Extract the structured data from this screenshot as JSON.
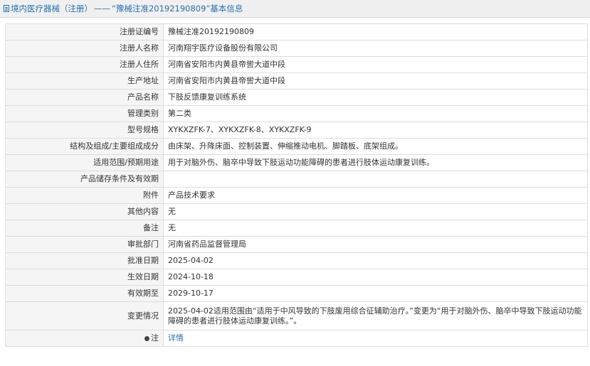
{
  "header": {
    "title_left": "境内医疗器械（注册）",
    "separator": "——",
    "title_right": "“豫械注准20192190809”基本信息"
  },
  "rows": [
    {
      "label": "注册证编号",
      "value": "豫械注准20192190809"
    },
    {
      "label": "注册人名称",
      "value": "河南翔宇医疗设备股份有限公司"
    },
    {
      "label": "注册人住所",
      "value": "河南省安阳市内黄县帝喾大道中段"
    },
    {
      "label": "生产地址",
      "value": "河南省安阳市内黄县帝喾大道中段"
    },
    {
      "label": "产品名称",
      "value": "下肢反馈康复训练系统"
    },
    {
      "label": "管理类别",
      "value": "第二类"
    },
    {
      "label": "型号规格",
      "value": "XYKXZFK-7、XYKXZFK-8、XYKXZFK-9"
    },
    {
      "label": "结构及组成/主要组成成分",
      "value": "由床架、升降床面、控制装置、伸缩推动电机、脚踏板、底架组成。"
    },
    {
      "label": "适用范围/预期用途",
      "value": "用于对脑外伤、脑卒中导致下肢运动功能障碍的患者进行肢体运动康复训练。"
    },
    {
      "label": "产品储存条件及有效期",
      "value": ""
    },
    {
      "label": "附件",
      "value": "产品技术要求"
    },
    {
      "label": "其他内容",
      "value": "无"
    },
    {
      "label": "备注",
      "value": "无"
    },
    {
      "label": "审批部门",
      "value": "河南省药品监督管理局"
    },
    {
      "label": "批准日期",
      "value": "2025-04-02"
    },
    {
      "label": "生效日期",
      "value": "2024-10-18"
    },
    {
      "label": "有效期至",
      "value": "2029-10-17"
    },
    {
      "label": "变更情况",
      "value": "2025-04-02适用范围由“适用于中风导致的下肢废用综合征辅助治疗。”变更为“用于对脑外伤、脑卒中导致下肢运动功能障碍的患者进行肢体运动康复训练。”。"
    }
  ],
  "footer_row": {
    "label": "注",
    "label_icon": "bullet-icon",
    "link_text": "详情"
  }
}
